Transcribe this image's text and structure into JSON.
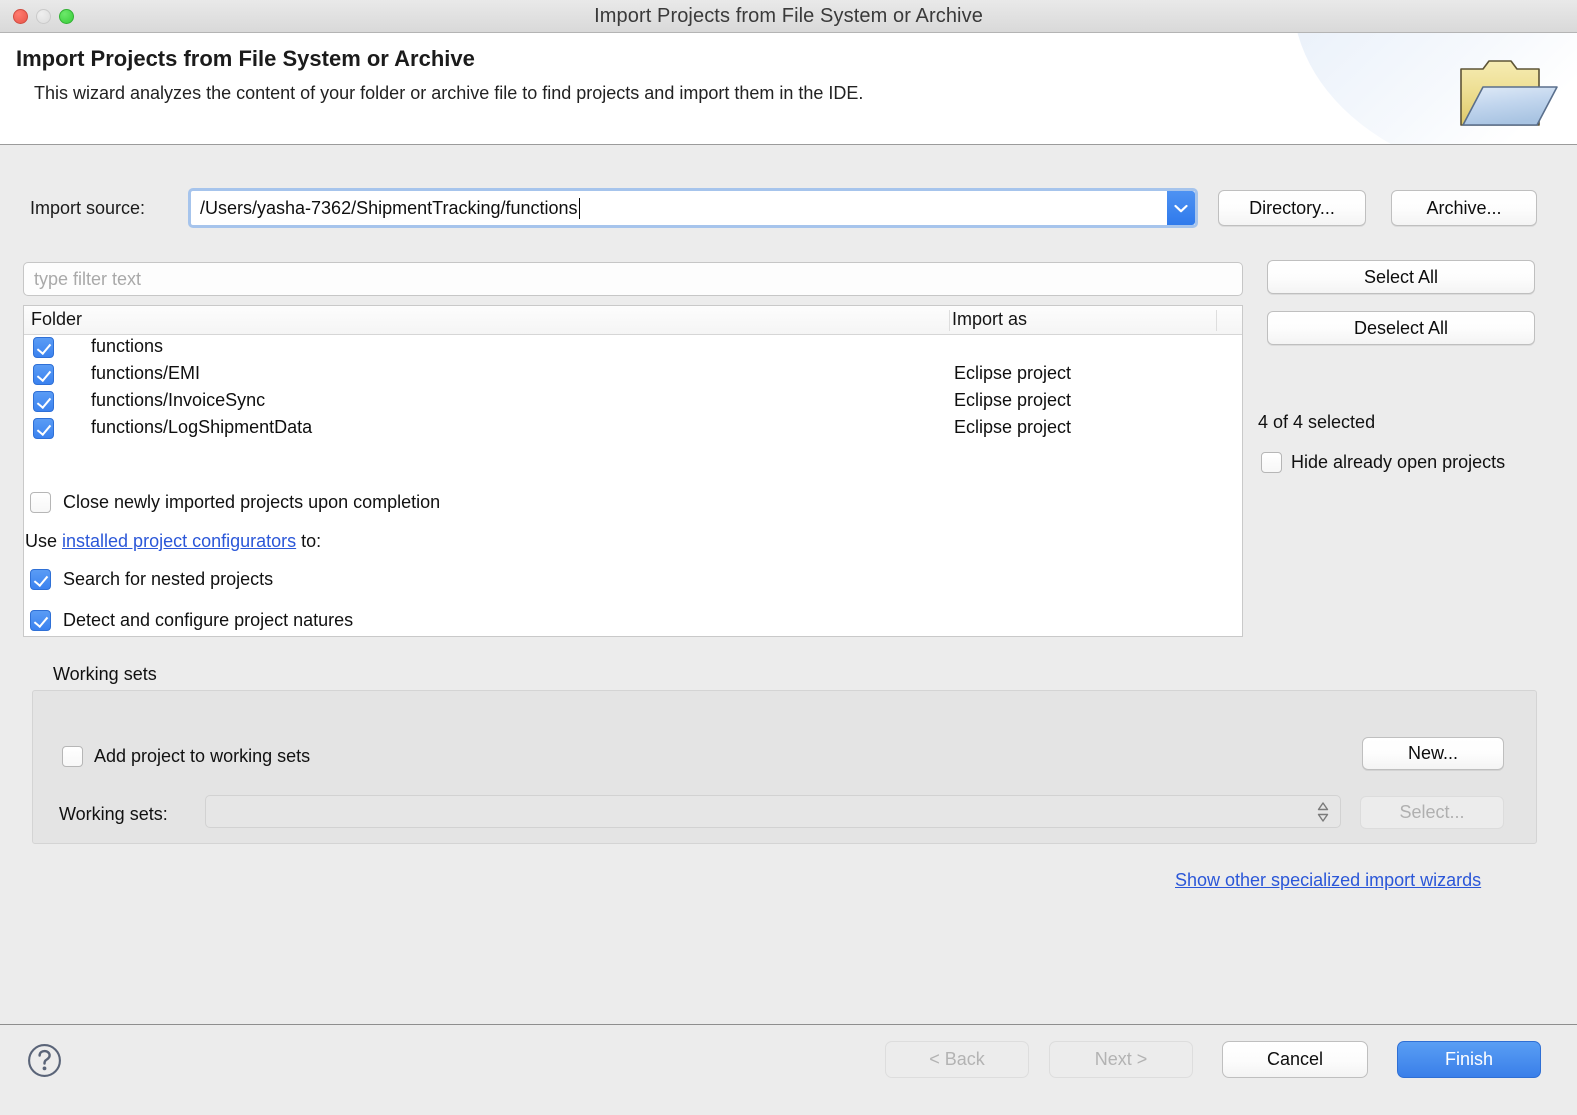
{
  "window": {
    "title": "Import Projects from File System or Archive",
    "traffic_lights": [
      "close",
      "minimize",
      "maximize"
    ]
  },
  "banner": {
    "title": "Import Projects from File System or Archive",
    "subtitle": "This wizard analyzes the content of your folder or archive file to find projects and import them in the IDE.",
    "icon": "folder-import-icon"
  },
  "import_source": {
    "label": "Import source:",
    "value": "/Users/yasha-7362/ShipmentTracking/functions",
    "placeholder": "",
    "dropdown_icon": "chevron-down-icon",
    "directory_button": "Directory...",
    "archive_button": "Archive..."
  },
  "filter": {
    "placeholder": "type filter text",
    "value": ""
  },
  "table": {
    "columns": [
      "Folder",
      "Import as"
    ],
    "rows": [
      {
        "checked": true,
        "folder": "functions",
        "import_as": ""
      },
      {
        "checked": true,
        "folder": "functions/EMI",
        "import_as": "Eclipse project"
      },
      {
        "checked": true,
        "folder": "functions/InvoiceSync",
        "import_as": "Eclipse project"
      },
      {
        "checked": true,
        "folder": "functions/LogShipmentData",
        "import_as": "Eclipse project"
      }
    ]
  },
  "side_panel": {
    "select_all": "Select All",
    "deselect_all": "Deselect All",
    "selected_count": "4 of 4 selected",
    "hide_already_open": {
      "label": "Hide already open projects",
      "checked": false
    }
  },
  "options": {
    "close_newly_imported": {
      "label": "Close newly imported projects upon completion",
      "checked": false
    },
    "configurators_prefix": "Use ",
    "configurators_link": "installed project configurators",
    "configurators_suffix": " to:",
    "search_nested": {
      "label": "Search for nested projects",
      "checked": true
    },
    "detect_natures": {
      "label": "Detect and configure project natures",
      "checked": true
    }
  },
  "working_sets": {
    "legend": "Working sets",
    "add_to_working_sets": {
      "label": "Add project to working sets",
      "checked": false
    },
    "sets_label": "Working sets:",
    "sets_value": "",
    "new_button": "New...",
    "select_button": "Select...",
    "select_button_enabled": false
  },
  "other_wizards_link": "Show other specialized import wizards",
  "footer": {
    "help_icon": "help-question-icon",
    "back": {
      "label": "< Back",
      "enabled": false
    },
    "next": {
      "label": "Next >",
      "enabled": false
    },
    "cancel": {
      "label": "Cancel",
      "enabled": true
    },
    "finish": {
      "label": "Finish",
      "enabled": true,
      "is_default": true
    }
  },
  "colors": {
    "accent_blue": "#3a7fe9",
    "link_blue": "#2b57d8",
    "checkbox_blue": "#3b82ef",
    "window_bg": "#ececec",
    "banner_bg": "#ffffff",
    "folder_yellow": "#eadb8a",
    "folder_sheet_blue": "#b8cfe8"
  }
}
